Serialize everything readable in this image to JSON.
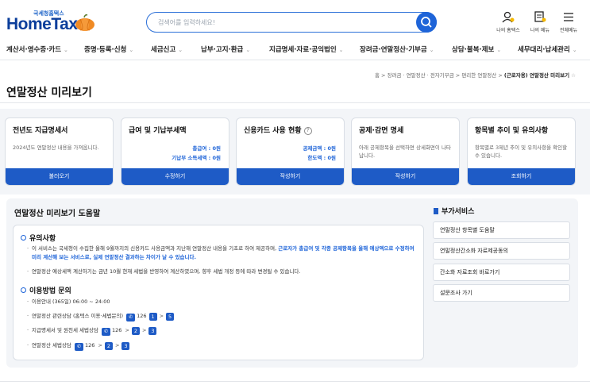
{
  "logo": {
    "sub": "국세청홈택스",
    "main": "HomeTax"
  },
  "search": {
    "placeholder": "검색어를 입력하세요!"
  },
  "utility": [
    {
      "label": "나의 홈택스",
      "icon": "user-icon"
    },
    {
      "label": "나의 메뉴",
      "icon": "my-menu-icon"
    },
    {
      "label": "전체메뉴",
      "icon": "hamburger-icon"
    }
  ],
  "nav": [
    "계산서·영수증·카드",
    "증명·등록·신청",
    "세금신고",
    "납부·고지·환급",
    "지급명세·자료·공익법인",
    "장려금·연말정산·기부금",
    "상담·불복·제보",
    "세무대리·납세관리"
  ],
  "breadcrumb": [
    "홈",
    "장려금 · 연말정산 · 전자기부금",
    "편리한 연말정산"
  ],
  "breadcrumb_current": "(근로자용) 연말정산 미리보기",
  "page_title": "연말정산 미리보기",
  "cards": [
    {
      "title": "전년도 지급명세서",
      "desc": "2024년도 연말정산 내용을 가져옵니다.",
      "button": "불러오기"
    },
    {
      "title": "급여 및 기납부세액",
      "line1": "총급여 : 0원",
      "line2": "기납부 소득세액 : 0원",
      "button": "수정하기"
    },
    {
      "title": "신용카드 사용 현황",
      "line1": "공제금액 : 0원",
      "line2": "한도액 : 0원",
      "button": "작성하기",
      "help": "?"
    },
    {
      "title": "공제·감면 명세",
      "desc": "아래 공제항목을 선택하면 상세화면이 나타납니다.",
      "button": "작성하기"
    },
    {
      "title": "항목별 추이 및 유의사항",
      "desc": "항목별로 3제년 추이 및 유의사항을 확인할 수 있습니다.",
      "button": "조회하기"
    }
  ],
  "help": {
    "title": "연말정산 미리보기 도움말",
    "notice_title": "유의사항",
    "notice1_a": "이 서비스는 국세청이 수집한 올해 9월까지의 신용카드 사용금액과 지난해 연말정산 내용을 기초로 하여 제공하며,",
    "notice1_b": "근로자가 총급여 및 각종 공제항목을 올해 예상액으로 수정하여 미리 계산해 보는 서비스로, 실제 연말정산 결과하는 차이가 날 수 있습니다.",
    "notice2": "연말정산 예상세액 계산하기는 금년 10월 현재 세법을 반영하여 계산하였으며, 향후 세법 개정 등에 따라 변경될 수 있습니다.",
    "contact_title": "이용방법 문의",
    "hours": "이용안내 (365일) 06:00 ~ 24:00",
    "c1": "연말정산 관련상담 (홈텍스 이용·세법문의)",
    "c1_num": "126",
    "c1_a": "1",
    "c1_b": "5",
    "c2": "지급명세서 및 원천세 세법상담",
    "c2_num": "126",
    "c2_a": "2",
    "c2_b": "3",
    "c3": "연말정산 세법상담",
    "c3_num": "126",
    "c3_a": "2",
    "c3_b": "3"
  },
  "side": {
    "title": "부가서비스",
    "items": [
      "연말정산 항목별 도움말",
      "연말정산간소화 자료제공동의",
      "간소화 자료조회 바로가기",
      "설문조사 가기"
    ]
  },
  "colors": {
    "primary": "#1e5bc6",
    "accent": "#1e64d8",
    "logo": "#0b3e9b"
  }
}
